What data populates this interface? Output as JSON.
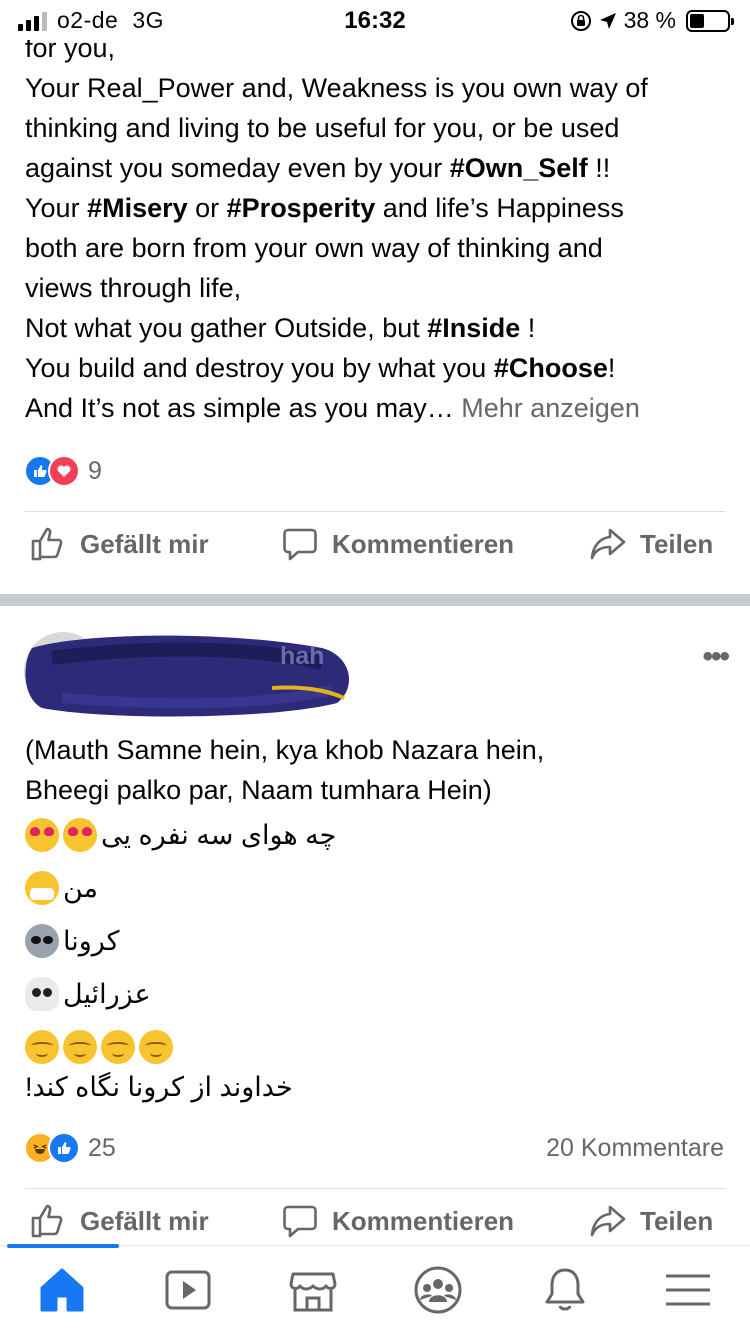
{
  "status_bar": {
    "carrier": "o2-de",
    "network": "3G",
    "time": "16:32",
    "battery_percent": "38 %",
    "battery_level": 0.38
  },
  "post1": {
    "lines": [
      "for you,",
      "Your Real_Power and, Weakness is you own way of",
      "thinking and living to be useful for you, or be used",
      "against you someday even by your ",
      "Your ",
      "both are born from your own way of thinking and",
      "views through life,",
      "Not what you gather Outside, but ",
      "You build and destroy you by what you ",
      "And It’s not as simple as you may…"
    ],
    "hashtag_own_self": "#Own_Self",
    "after_own_self": " !!",
    "hashtag_misery": "#Misery",
    "word_or": " or ",
    "hashtag_prosperity": "#Prosperity",
    "after_prosperity": " and life’s Happiness",
    "hashtag_inside": "#Inside",
    "after_inside": " !",
    "hashtag_choose": "#Choose",
    "after_choose": "!",
    "see_more": "Mehr anzeigen",
    "reaction_count": "9",
    "actions": {
      "like": "Gefällt mir",
      "comment": "Kommentieren",
      "share": "Teilen"
    }
  },
  "post2": {
    "author_fragment": "hah",
    "more_icon": "•••",
    "text_line1": "(Mauth Samne hein, kya khob Nazara hein,",
    "text_line2": "Bheegi palko par, Naam tumhara Hein)",
    "persian_line1": "چه هوای سه نفره یی",
    "persian_line2": "من",
    "persian_line3": "کرونا",
    "persian_line4": "عزرائیل",
    "persian_line6": "خداوند از کرونا نگاه کند!",
    "reaction_count": "25",
    "comment_count": "20 Kommentare",
    "actions": {
      "like": "Gefällt mir",
      "comment": "Kommentieren",
      "share": "Teilen"
    }
  },
  "bottom_nav": [
    {
      "icon": "home-icon",
      "active": true
    },
    {
      "icon": "video-icon",
      "active": false
    },
    {
      "icon": "marketplace-icon",
      "active": false
    },
    {
      "icon": "groups-icon",
      "active": false
    },
    {
      "icon": "bell-icon",
      "active": false
    },
    {
      "icon": "menu-icon",
      "active": false
    }
  ],
  "colors": {
    "accent": "#1877f2",
    "secondary_text": "#65676b",
    "love": "#f33e58"
  }
}
